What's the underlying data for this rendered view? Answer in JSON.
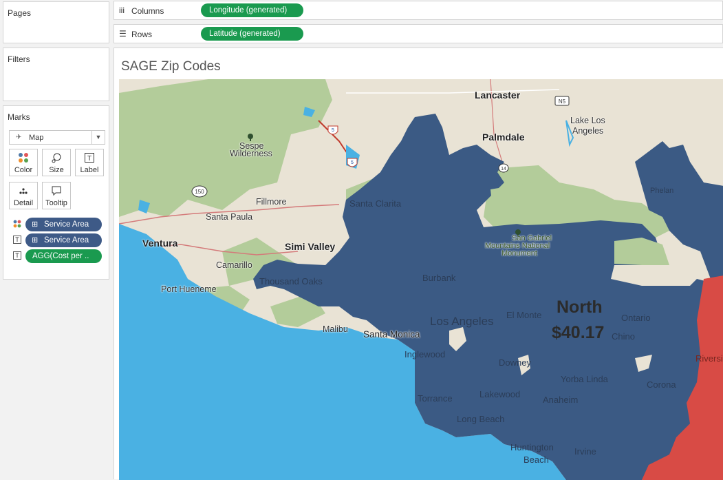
{
  "pages": {
    "title": "Pages"
  },
  "filters": {
    "title": "Filters"
  },
  "marks": {
    "title": "Marks",
    "mark_type": "Map",
    "buttons": {
      "color": "Color",
      "size": "Size",
      "label": "Label",
      "detail": "Detail",
      "tooltip": "Tooltip"
    },
    "pills": [
      "Service Area",
      "Service Area",
      "AGG(Cost per .."
    ]
  },
  "shelves": {
    "columns": {
      "label": "Columns",
      "pill": "Longitude (generated)"
    },
    "rows": {
      "label": "Rows",
      "pill": "Latitude (generated)"
    }
  },
  "viz": {
    "title": "SAGE Zip Codes",
    "region_label": {
      "name": "North",
      "value": "$40.17"
    },
    "places": {
      "lancaster": "Lancaster",
      "palmdale": "Palmdale",
      "lake_los_angeles_1": "Lake Los",
      "lake_los_angeles_2": "Angeles",
      "sespe_1": "Sespe",
      "sespe_2": "Wilderness",
      "fillmore": "Fillmore",
      "santa_paula": "Santa Paula",
      "ventura": "Ventura",
      "simi_valley": "Simi Valley",
      "camarillo": "Camarillo",
      "port_hueneme": "Port Hueneme",
      "thousand_oaks": "Thousand Oaks",
      "santa_clarita": "Santa Clarita",
      "san_gabriel_1": "San Gabriel",
      "san_gabriel_2": "Mountains National",
      "san_gabriel_3": "Monument",
      "burbank": "Burbank",
      "los_angeles": "Los Angeles",
      "el_monte": "El Monte",
      "ontario": "Ontario",
      "chino": "Chino",
      "malibu": "Malibu",
      "santa_monica": "Santa Monica",
      "inglewood": "Inglewood",
      "downey": "Downey",
      "yorba_linda": "Yorba Linda",
      "corona": "Corona",
      "riverside": "Riverside",
      "torrance": "Torrance",
      "lakewood": "Lakewood",
      "anaheim": "Anaheim",
      "long_beach": "Long Beach",
      "huntington_1": "Huntington",
      "huntington_2": "Beach",
      "irvine": "Irvine",
      "phelan": "Phelan"
    },
    "shields": {
      "i5_a": "5",
      "i5_b": "5",
      "n5": "N5",
      "r150": "150",
      "r14": "14"
    },
    "colors": {
      "north": "#3b5a84",
      "south": "#d84b45",
      "ocean": "#4ab1e3",
      "land": "#e9e3d5",
      "park": "#a9c98f"
    }
  }
}
